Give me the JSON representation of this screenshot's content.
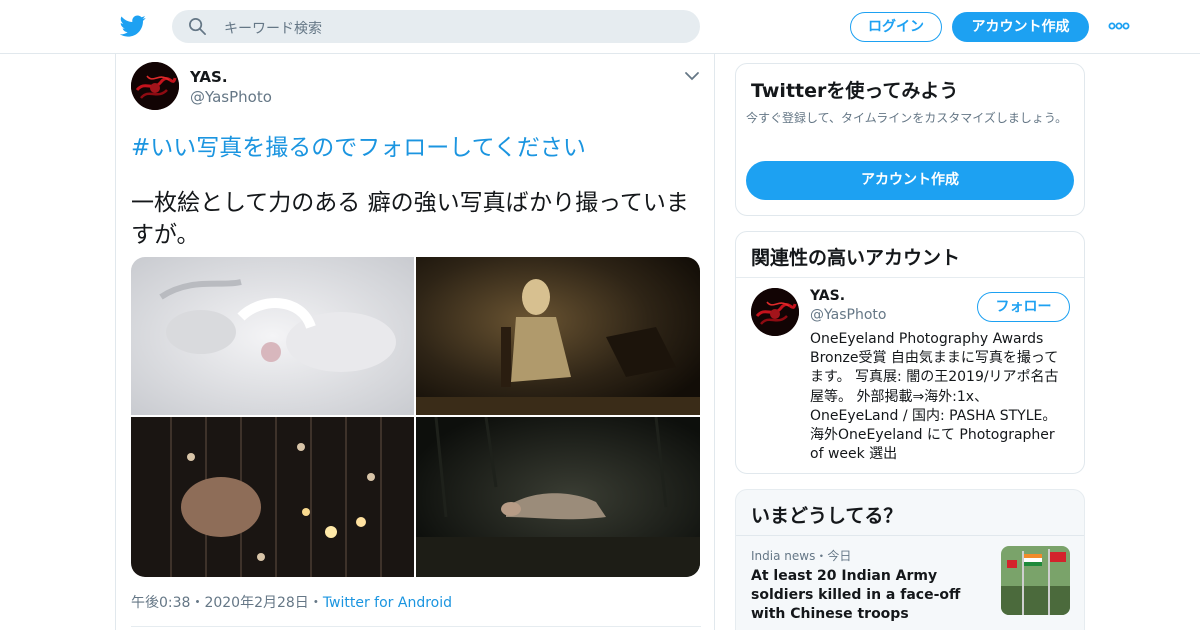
{
  "header": {
    "search_placeholder": "キーワード検索",
    "login_label": "ログイン",
    "signup_label": "アカウント作成"
  },
  "tweet": {
    "display_name": "YAS.",
    "handle": "@YasPhoto",
    "hashtag": "#いい写真を撮るのでフォローしてください",
    "text": "一枚絵として力のある 癖の強い写真ばかり撮っていますが。",
    "time": "午後0:38",
    "date": "2020年2月28日",
    "source": "Twitter for Android",
    "separator": "・",
    "photos": [
      "white-scene-photo",
      "dark-room-doll-photo",
      "caged-candles-photo",
      "forest-floor-photo"
    ]
  },
  "signup_card": {
    "title": "Twitterを使ってみよう",
    "subtitle": "今すぐ登録して、タイムラインをカスタマイズしましょう。",
    "button": "アカウント作成"
  },
  "related_card": {
    "title": "関連性の高いアカウント",
    "account": {
      "display_name": "YAS.",
      "handle": "@YasPhoto",
      "follow_label": "フォロー",
      "bio": "OneEyeland Photography Awards Bronze受賞 自由気ままに写真を撮ってます。 写真展: 闇の王2019/リアポ名古屋等。 外部掲載⇒海外:1x、OneEyeLand / 国内: PASHA STYLE。　海外OneEyeland にて Photographer of week 選出"
    }
  },
  "trends_card": {
    "title": "いまどうしてる？",
    "item": {
      "source": "India news",
      "separator": "・",
      "time": "今日",
      "headline": "At least 20 Indian Army soldiers killed in a face-off with Chinese troops"
    }
  },
  "colors": {
    "twitter_blue": "#1da1f2",
    "link_blue": "#1b95e0",
    "muted_text": "#657786",
    "border": "#e1e8ed"
  }
}
